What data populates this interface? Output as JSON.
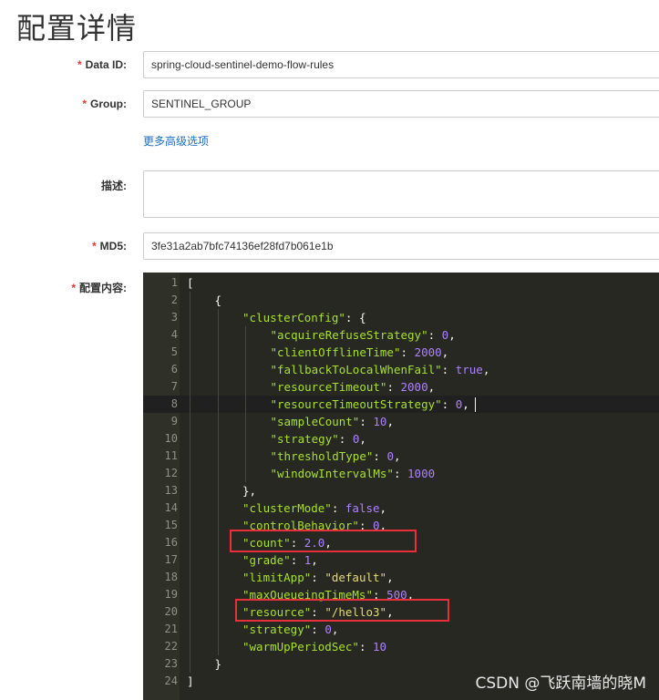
{
  "page": {
    "title": "配置详情"
  },
  "form": {
    "required_mark": "*",
    "data_id": {
      "label": "Data ID:",
      "value": "spring-cloud-sentinel-demo-flow-rules"
    },
    "group": {
      "label": "Group:",
      "value": "SENTINEL_GROUP"
    },
    "advanced_link": "更多高级选项",
    "description": {
      "label": "描述:",
      "value": ""
    },
    "md5": {
      "label": "MD5:",
      "value": "3fe31a2ab7bfc74136ef28fd7b061e1b"
    },
    "content": {
      "label": "配置内容:"
    }
  },
  "editor": {
    "theme_colors": {
      "background": "#272822",
      "key": "#a6e22e",
      "string": "#e6db74",
      "number": "#ae81ff",
      "text": "#f8f8f2",
      "highlight_box": "#e8303a"
    },
    "active_line": 8,
    "highlighted_lines": [
      16,
      20
    ],
    "lines": [
      {
        "n": "1",
        "indent": 0,
        "tokens": [
          [
            "p",
            "["
          ]
        ]
      },
      {
        "n": "2",
        "indent": 1,
        "tokens": [
          [
            "p",
            "{"
          ]
        ]
      },
      {
        "n": "3",
        "indent": 2,
        "tokens": [
          [
            "k",
            "\"clusterConfig\""
          ],
          [
            "p",
            ": {"
          ]
        ]
      },
      {
        "n": "4",
        "indent": 3,
        "tokens": [
          [
            "k",
            "\"acquireRefuseStrategy\""
          ],
          [
            "p",
            ": "
          ],
          [
            "n",
            "0"
          ],
          [
            "p",
            ","
          ]
        ]
      },
      {
        "n": "5",
        "indent": 3,
        "tokens": [
          [
            "k",
            "\"clientOfflineTime\""
          ],
          [
            "p",
            ": "
          ],
          [
            "n",
            "2000"
          ],
          [
            "p",
            ","
          ]
        ]
      },
      {
        "n": "6",
        "indent": 3,
        "tokens": [
          [
            "k",
            "\"fallbackToLocalWhenFail\""
          ],
          [
            "p",
            ": "
          ],
          [
            "n",
            "true"
          ],
          [
            "p",
            ","
          ]
        ]
      },
      {
        "n": "7",
        "indent": 3,
        "tokens": [
          [
            "k",
            "\"resourceTimeout\""
          ],
          [
            "p",
            ": "
          ],
          [
            "n",
            "2000"
          ],
          [
            "p",
            ","
          ]
        ]
      },
      {
        "n": "8",
        "indent": 3,
        "tokens": [
          [
            "k",
            "\"resourceTimeoutStrategy\""
          ],
          [
            "p",
            ": "
          ],
          [
            "n",
            "0"
          ],
          [
            "p",
            ","
          ]
        ]
      },
      {
        "n": "9",
        "indent": 3,
        "tokens": [
          [
            "k",
            "\"sampleCount\""
          ],
          [
            "p",
            ": "
          ],
          [
            "n",
            "10"
          ],
          [
            "p",
            ","
          ]
        ]
      },
      {
        "n": "10",
        "indent": 3,
        "tokens": [
          [
            "k",
            "\"strategy\""
          ],
          [
            "p",
            ": "
          ],
          [
            "n",
            "0"
          ],
          [
            "p",
            ","
          ]
        ]
      },
      {
        "n": "11",
        "indent": 3,
        "tokens": [
          [
            "k",
            "\"thresholdType\""
          ],
          [
            "p",
            ": "
          ],
          [
            "n",
            "0"
          ],
          [
            "p",
            ","
          ]
        ]
      },
      {
        "n": "12",
        "indent": 3,
        "tokens": [
          [
            "k",
            "\"windowIntervalMs\""
          ],
          [
            "p",
            ": "
          ],
          [
            "n",
            "1000"
          ]
        ]
      },
      {
        "n": "13",
        "indent": 2,
        "tokens": [
          [
            "p",
            "},"
          ]
        ]
      },
      {
        "n": "14",
        "indent": 2,
        "tokens": [
          [
            "k",
            "\"clusterMode\""
          ],
          [
            "p",
            ": "
          ],
          [
            "n",
            "false"
          ],
          [
            "p",
            ","
          ]
        ]
      },
      {
        "n": "15",
        "indent": 2,
        "tokens": [
          [
            "k",
            "\"controlBehavior\""
          ],
          [
            "p",
            ": "
          ],
          [
            "n",
            "0"
          ],
          [
            "p",
            ","
          ]
        ]
      },
      {
        "n": "16",
        "indent": 2,
        "tokens": [
          [
            "k",
            "\"count\""
          ],
          [
            "p",
            ": "
          ],
          [
            "n",
            "2.0"
          ],
          [
            "p",
            ","
          ]
        ]
      },
      {
        "n": "17",
        "indent": 2,
        "tokens": [
          [
            "k",
            "\"grade\""
          ],
          [
            "p",
            ": "
          ],
          [
            "n",
            "1"
          ],
          [
            "p",
            ","
          ]
        ]
      },
      {
        "n": "18",
        "indent": 2,
        "tokens": [
          [
            "k",
            "\"limitApp\""
          ],
          [
            "p",
            ": "
          ],
          [
            "s",
            "\"default\""
          ],
          [
            "p",
            ","
          ]
        ]
      },
      {
        "n": "19",
        "indent": 2,
        "tokens": [
          [
            "k",
            "\"maxQueueingTimeMs\""
          ],
          [
            "p",
            ": "
          ],
          [
            "n",
            "500"
          ],
          [
            "p",
            ","
          ]
        ]
      },
      {
        "n": "20",
        "indent": 2,
        "tokens": [
          [
            "k",
            "\"resource\""
          ],
          [
            "p",
            ": "
          ],
          [
            "s",
            "\"/hello3\""
          ],
          [
            "p",
            ","
          ]
        ]
      },
      {
        "n": "21",
        "indent": 2,
        "tokens": [
          [
            "k",
            "\"strategy\""
          ],
          [
            "p",
            ": "
          ],
          [
            "n",
            "0"
          ],
          [
            "p",
            ","
          ]
        ]
      },
      {
        "n": "22",
        "indent": 2,
        "tokens": [
          [
            "k",
            "\"warmUpPeriodSec\""
          ],
          [
            "p",
            ": "
          ],
          [
            "n",
            "10"
          ]
        ]
      },
      {
        "n": "23",
        "indent": 1,
        "tokens": [
          [
            "p",
            "}"
          ]
        ]
      },
      {
        "n": "24",
        "indent": 0,
        "tokens": [
          [
            "p",
            "]"
          ]
        ]
      }
    ]
  },
  "watermark": "CSDN @飞跃南墙的晓M"
}
